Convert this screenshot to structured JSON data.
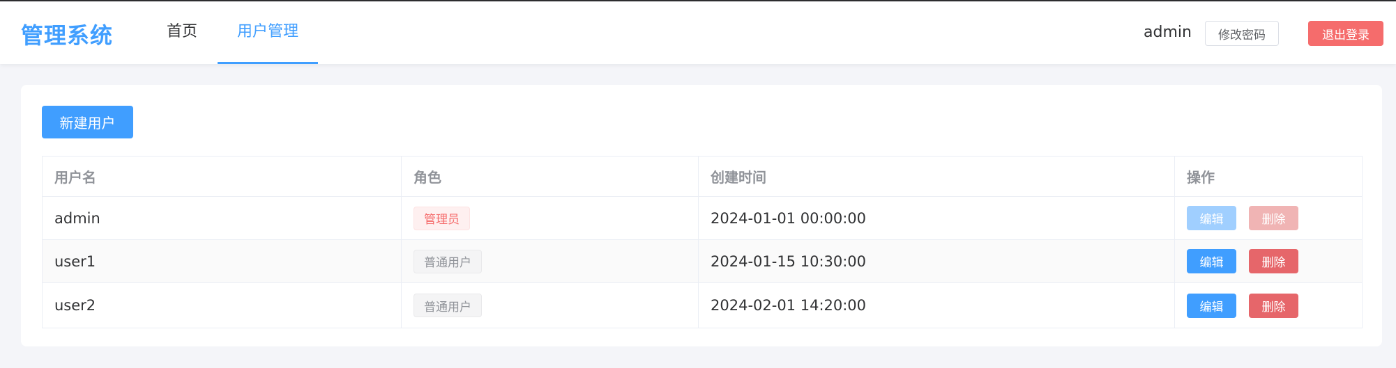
{
  "header": {
    "logo": "管理系统",
    "nav": [
      {
        "label": "首页"
      },
      {
        "label": "用户管理"
      }
    ],
    "username": "admin",
    "change_password_label": "修改密码",
    "logout_label": "退出登录"
  },
  "main": {
    "new_user_label": "新建用户",
    "table": {
      "columns": [
        "用户名",
        "角色",
        "创建时间",
        "操作"
      ],
      "rows": [
        {
          "username": "admin",
          "role": "管理员",
          "created": "2024-01-01 00:00:00",
          "edit": "编辑",
          "delete": "删除"
        },
        {
          "username": "user1",
          "role": "普通用户",
          "created": "2024-01-15 10:30:00",
          "edit": "编辑",
          "delete": "删除"
        },
        {
          "username": "user2",
          "role": "普通用户",
          "created": "2024-02-01 14:20:00",
          "edit": "编辑",
          "delete": "删除"
        }
      ]
    }
  },
  "colors": {
    "primary": "#409eff",
    "danger": "#f56c6c",
    "background": "#f4f5f9"
  }
}
